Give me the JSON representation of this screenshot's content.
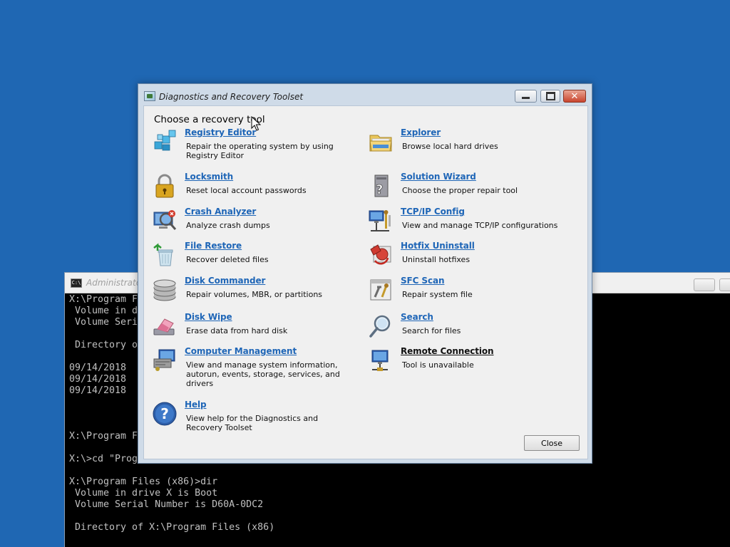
{
  "console": {
    "title": "Administrator",
    "lines": [
      "X:\\Program F",
      " Volume in d",
      " Volume Seri",
      "",
      " Directory o",
      "",
      "09/14/2018",
      "09/14/2018",
      "09/14/2018",
      "",
      "",
      "",
      "X:\\Program F",
      "",
      "X:\\>cd \"Prog",
      "",
      "X:\\Program Files (x86)>dir",
      " Volume in drive X is Boot",
      " Volume Serial Number is D60A-0DC2",
      "",
      " Directory of X:\\Program Files (x86)",
      "",
      ""
    ]
  },
  "dialog": {
    "title": "Diagnostics and Recovery Toolset",
    "heading": "Choose a recovery tool",
    "close_label": "Close",
    "tools": [
      {
        "name": "Registry Editor",
        "desc": "Repair the operating system by using Registry Editor",
        "icon": "registry-icon",
        "col": 0,
        "row": 0,
        "enabled": true
      },
      {
        "name": "Locksmith",
        "desc": "Reset local account passwords",
        "icon": "padlock-icon",
        "col": 0,
        "row": 1,
        "enabled": true
      },
      {
        "name": "Crash Analyzer",
        "desc": "Analyze crash dumps",
        "icon": "crash-analyzer-icon",
        "col": 0,
        "row": 2,
        "enabled": true
      },
      {
        "name": "File Restore",
        "desc": "Recover deleted files",
        "icon": "recycle-bin-icon",
        "col": 0,
        "row": 3,
        "enabled": true
      },
      {
        "name": "Disk Commander",
        "desc": "Repair volumes, MBR, or partitions",
        "icon": "disk-stack-icon",
        "col": 0,
        "row": 4,
        "enabled": true
      },
      {
        "name": "Disk Wipe",
        "desc": "Erase data from hard disk",
        "icon": "eraser-icon",
        "col": 0,
        "row": 5,
        "enabled": true
      },
      {
        "name": "Computer Management",
        "desc": "View and manage system information, autorun, events, storage, services, and drivers",
        "icon": "computer-management-icon",
        "col": 0,
        "row": 6,
        "enabled": true
      },
      {
        "name": "Help",
        "desc": "View help for the Diagnostics and Recovery Toolset",
        "icon": "help-icon",
        "col": 0,
        "row": 7,
        "enabled": true
      },
      {
        "name": "Explorer",
        "desc": "Browse local hard drives",
        "icon": "folder-icon",
        "col": 1,
        "row": 0,
        "enabled": true
      },
      {
        "name": "Solution Wizard",
        "desc": "Choose the proper repair tool",
        "icon": "wizard-icon",
        "col": 1,
        "row": 1,
        "enabled": true
      },
      {
        "name": "TCP/IP Config",
        "desc": "View and manage TCP/IP configurations",
        "icon": "network-config-icon",
        "col": 1,
        "row": 2,
        "enabled": true
      },
      {
        "name": "Hotfix Uninstall",
        "desc": "Uninstall hotfixes",
        "icon": "hotfix-icon",
        "col": 1,
        "row": 3,
        "enabled": true
      },
      {
        "name": "SFC Scan",
        "desc": "Repair system file",
        "icon": "sfc-scan-icon",
        "col": 1,
        "row": 4,
        "enabled": true
      },
      {
        "name": "Search",
        "desc": "Search for files",
        "icon": "magnifier-icon",
        "col": 1,
        "row": 5,
        "enabled": true
      },
      {
        "name": "Remote Connection",
        "desc": "Tool is unavailable",
        "icon": "remote-connection-icon",
        "col": 1,
        "row": 6,
        "enabled": false
      }
    ]
  }
}
